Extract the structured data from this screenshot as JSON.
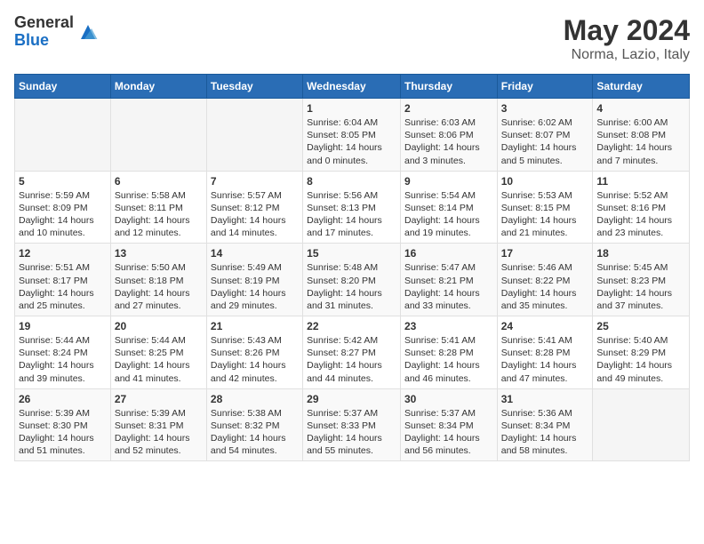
{
  "header": {
    "logo_general": "General",
    "logo_blue": "Blue",
    "month": "May 2024",
    "location": "Norma, Lazio, Italy"
  },
  "days_of_week": [
    "Sunday",
    "Monday",
    "Tuesday",
    "Wednesday",
    "Thursday",
    "Friday",
    "Saturday"
  ],
  "weeks": [
    [
      {
        "day": "",
        "info": ""
      },
      {
        "day": "",
        "info": ""
      },
      {
        "day": "",
        "info": ""
      },
      {
        "day": "1",
        "info": "Sunrise: 6:04 AM\nSunset: 8:05 PM\nDaylight: 14 hours\nand 0 minutes."
      },
      {
        "day": "2",
        "info": "Sunrise: 6:03 AM\nSunset: 8:06 PM\nDaylight: 14 hours\nand 3 minutes."
      },
      {
        "day": "3",
        "info": "Sunrise: 6:02 AM\nSunset: 8:07 PM\nDaylight: 14 hours\nand 5 minutes."
      },
      {
        "day": "4",
        "info": "Sunrise: 6:00 AM\nSunset: 8:08 PM\nDaylight: 14 hours\nand 7 minutes."
      }
    ],
    [
      {
        "day": "5",
        "info": "Sunrise: 5:59 AM\nSunset: 8:09 PM\nDaylight: 14 hours\nand 10 minutes."
      },
      {
        "day": "6",
        "info": "Sunrise: 5:58 AM\nSunset: 8:11 PM\nDaylight: 14 hours\nand 12 minutes."
      },
      {
        "day": "7",
        "info": "Sunrise: 5:57 AM\nSunset: 8:12 PM\nDaylight: 14 hours\nand 14 minutes."
      },
      {
        "day": "8",
        "info": "Sunrise: 5:56 AM\nSunset: 8:13 PM\nDaylight: 14 hours\nand 17 minutes."
      },
      {
        "day": "9",
        "info": "Sunrise: 5:54 AM\nSunset: 8:14 PM\nDaylight: 14 hours\nand 19 minutes."
      },
      {
        "day": "10",
        "info": "Sunrise: 5:53 AM\nSunset: 8:15 PM\nDaylight: 14 hours\nand 21 minutes."
      },
      {
        "day": "11",
        "info": "Sunrise: 5:52 AM\nSunset: 8:16 PM\nDaylight: 14 hours\nand 23 minutes."
      }
    ],
    [
      {
        "day": "12",
        "info": "Sunrise: 5:51 AM\nSunset: 8:17 PM\nDaylight: 14 hours\nand 25 minutes."
      },
      {
        "day": "13",
        "info": "Sunrise: 5:50 AM\nSunset: 8:18 PM\nDaylight: 14 hours\nand 27 minutes."
      },
      {
        "day": "14",
        "info": "Sunrise: 5:49 AM\nSunset: 8:19 PM\nDaylight: 14 hours\nand 29 minutes."
      },
      {
        "day": "15",
        "info": "Sunrise: 5:48 AM\nSunset: 8:20 PM\nDaylight: 14 hours\nand 31 minutes."
      },
      {
        "day": "16",
        "info": "Sunrise: 5:47 AM\nSunset: 8:21 PM\nDaylight: 14 hours\nand 33 minutes."
      },
      {
        "day": "17",
        "info": "Sunrise: 5:46 AM\nSunset: 8:22 PM\nDaylight: 14 hours\nand 35 minutes."
      },
      {
        "day": "18",
        "info": "Sunrise: 5:45 AM\nSunset: 8:23 PM\nDaylight: 14 hours\nand 37 minutes."
      }
    ],
    [
      {
        "day": "19",
        "info": "Sunrise: 5:44 AM\nSunset: 8:24 PM\nDaylight: 14 hours\nand 39 minutes."
      },
      {
        "day": "20",
        "info": "Sunrise: 5:44 AM\nSunset: 8:25 PM\nDaylight: 14 hours\nand 41 minutes."
      },
      {
        "day": "21",
        "info": "Sunrise: 5:43 AM\nSunset: 8:26 PM\nDaylight: 14 hours\nand 42 minutes."
      },
      {
        "day": "22",
        "info": "Sunrise: 5:42 AM\nSunset: 8:27 PM\nDaylight: 14 hours\nand 44 minutes."
      },
      {
        "day": "23",
        "info": "Sunrise: 5:41 AM\nSunset: 8:28 PM\nDaylight: 14 hours\nand 46 minutes."
      },
      {
        "day": "24",
        "info": "Sunrise: 5:41 AM\nSunset: 8:28 PM\nDaylight: 14 hours\nand 47 minutes."
      },
      {
        "day": "25",
        "info": "Sunrise: 5:40 AM\nSunset: 8:29 PM\nDaylight: 14 hours\nand 49 minutes."
      }
    ],
    [
      {
        "day": "26",
        "info": "Sunrise: 5:39 AM\nSunset: 8:30 PM\nDaylight: 14 hours\nand 51 minutes."
      },
      {
        "day": "27",
        "info": "Sunrise: 5:39 AM\nSunset: 8:31 PM\nDaylight: 14 hours\nand 52 minutes."
      },
      {
        "day": "28",
        "info": "Sunrise: 5:38 AM\nSunset: 8:32 PM\nDaylight: 14 hours\nand 54 minutes."
      },
      {
        "day": "29",
        "info": "Sunrise: 5:37 AM\nSunset: 8:33 PM\nDaylight: 14 hours\nand 55 minutes."
      },
      {
        "day": "30",
        "info": "Sunrise: 5:37 AM\nSunset: 8:34 PM\nDaylight: 14 hours\nand 56 minutes."
      },
      {
        "day": "31",
        "info": "Sunrise: 5:36 AM\nSunset: 8:34 PM\nDaylight: 14 hours\nand 58 minutes."
      },
      {
        "day": "",
        "info": ""
      }
    ]
  ]
}
